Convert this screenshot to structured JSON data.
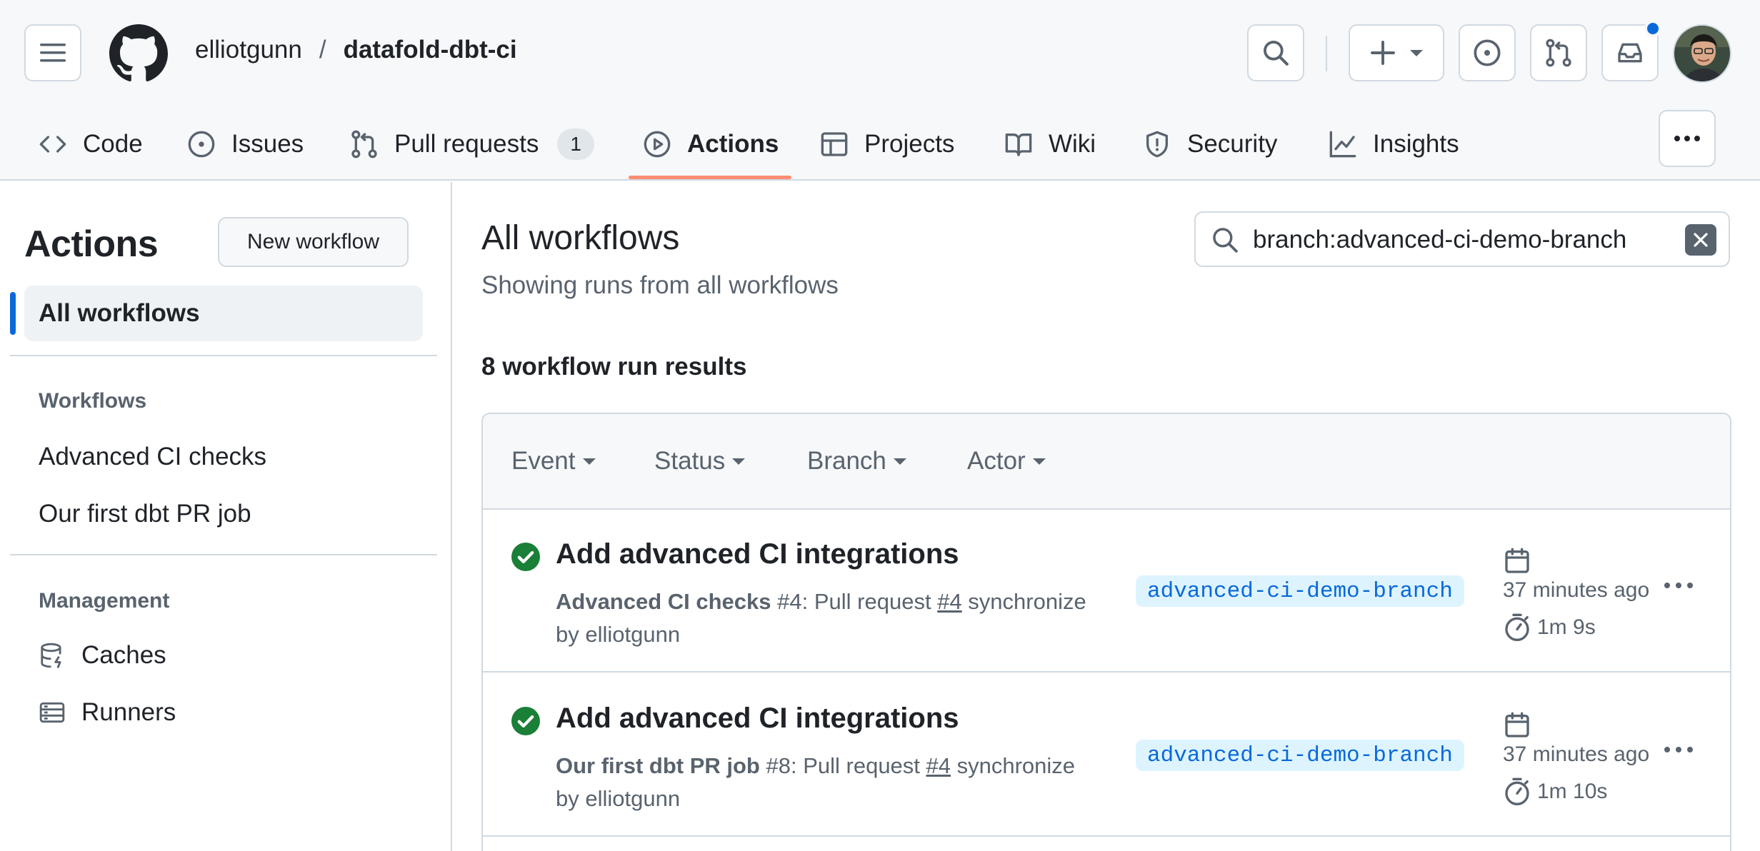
{
  "header": {
    "owner": "elliotgunn",
    "separator": "/",
    "repo": "datafold-dbt-ci"
  },
  "tabs": [
    {
      "label": "Code",
      "icon": "code-icon"
    },
    {
      "label": "Issues",
      "icon": "issue-opened-icon"
    },
    {
      "label": "Pull requests",
      "icon": "git-pull-request-icon",
      "count": "1"
    },
    {
      "label": "Actions",
      "icon": "play-icon",
      "active": true
    },
    {
      "label": "Projects",
      "icon": "table-icon"
    },
    {
      "label": "Wiki",
      "icon": "book-icon"
    },
    {
      "label": "Security",
      "icon": "shield-icon"
    },
    {
      "label": "Insights",
      "icon": "graph-icon"
    }
  ],
  "sidebar": {
    "title": "Actions",
    "new_workflow_label": "New workflow",
    "all_workflows_label": "All workflows",
    "workflows_heading": "Workflows",
    "workflows": [
      "Advanced CI checks",
      "Our first dbt PR job"
    ],
    "management_heading": "Management",
    "management": [
      {
        "label": "Caches",
        "icon": "database-icon"
      },
      {
        "label": "Runners",
        "icon": "server-icon"
      }
    ]
  },
  "main": {
    "title": "All workflows",
    "subtitle": "Showing runs from all workflows",
    "filter_value": "branch:advanced-ci-demo-branch",
    "results_count": "8 workflow run results",
    "filters": [
      "Event",
      "Status",
      "Branch",
      "Actor"
    ],
    "runs": [
      {
        "status": "success",
        "title": "Add advanced CI integrations",
        "workflow": "Advanced CI checks",
        "run_number": "#4",
        "event_prefix": ": Pull request ",
        "pr": "#4",
        "event_suffix": " synchronize",
        "by": "by elliotgunn",
        "branch": "advanced-ci-demo-branch",
        "time": "37 minutes ago",
        "duration": "1m 9s"
      },
      {
        "status": "success",
        "title": "Add advanced CI integrations",
        "workflow": "Our first dbt PR job",
        "run_number": "#8",
        "event_prefix": ": Pull request ",
        "pr": "#4",
        "event_suffix": " synchronize",
        "by": "by elliotgunn",
        "branch": "advanced-ci-demo-branch",
        "time": "37 minutes ago",
        "duration": "1m 10s"
      }
    ]
  },
  "colors": {
    "accent_underline": "#fd8c73",
    "success": "#1a7f37",
    "link_blue": "#0969da",
    "branch_bg": "#ddf4ff",
    "notification_dot": "#0969da"
  }
}
